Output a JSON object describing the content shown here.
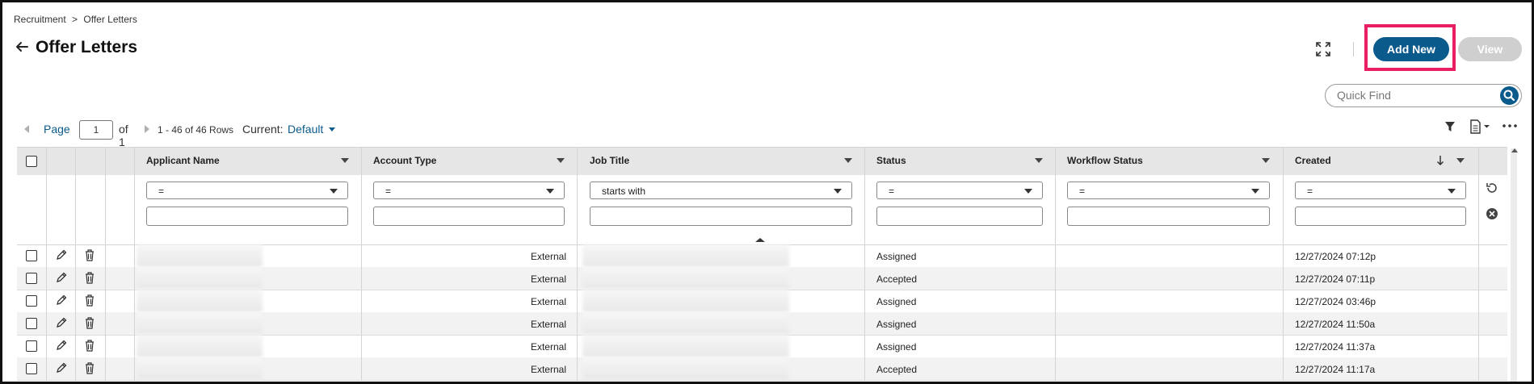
{
  "breadcrumb": {
    "parent": "Recruitment",
    "separator": ">",
    "current": "Offer Letters"
  },
  "page": {
    "title": "Offer Letters"
  },
  "actions": {
    "add_new": "Add New",
    "view": "View"
  },
  "quick_find": {
    "placeholder": "Quick Find"
  },
  "pager": {
    "page_label": "Page",
    "page_value": "1",
    "of_label": "of 1",
    "rows_label": "1 - 46 of 46 Rows",
    "current_label": "Current:",
    "current_view": "Default"
  },
  "table": {
    "columns": [
      "Applicant Name",
      "Account Type",
      "Job Title",
      "Status",
      "Workflow Status",
      "Created"
    ],
    "filters": [
      "=",
      "=",
      "starts with",
      "=",
      "=",
      "="
    ],
    "rows": [
      {
        "account_type": "External",
        "status": "Assigned",
        "workflow_status": "",
        "created": "12/27/2024 07:12p"
      },
      {
        "account_type": "External",
        "status": "Accepted",
        "workflow_status": "",
        "created": "12/27/2024 07:11p"
      },
      {
        "account_type": "External",
        "status": "Assigned",
        "workflow_status": "",
        "created": "12/27/2024 03:46p"
      },
      {
        "account_type": "External",
        "status": "Assigned",
        "workflow_status": "",
        "created": "12/27/2024 11:50a"
      },
      {
        "account_type": "External",
        "status": "Assigned",
        "workflow_status": "",
        "created": "12/27/2024 11:37a"
      },
      {
        "account_type": "External",
        "status": "Accepted",
        "workflow_status": "",
        "created": "12/27/2024 11:17a"
      }
    ]
  },
  "colors": {
    "primary": "#0b5a8c",
    "highlight": "#e91e63",
    "header_bg": "#e6e6e6",
    "disabled_button": "#cfcfcf"
  },
  "icons": [
    "back-arrow-icon",
    "expand-icon",
    "search-icon",
    "filter-icon",
    "export-icon",
    "more-icon",
    "edit-icon",
    "delete-icon",
    "refresh-icon",
    "clear-filter-icon",
    "sort-desc-icon"
  ]
}
